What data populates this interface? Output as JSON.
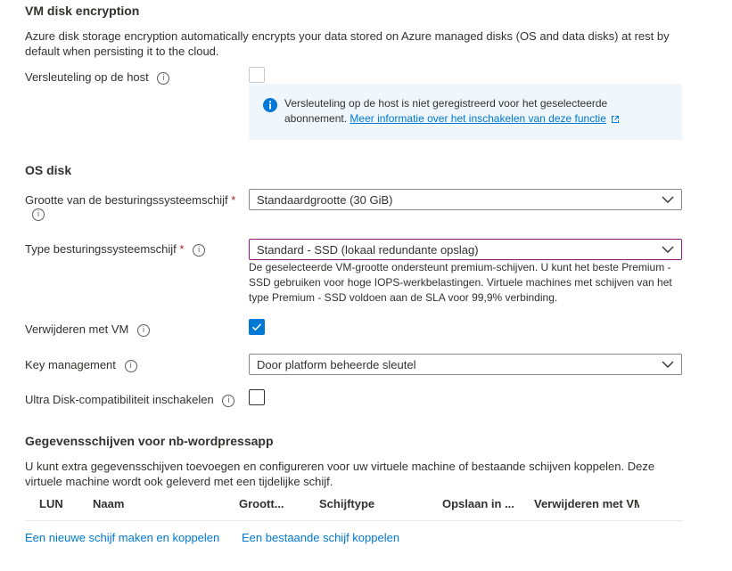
{
  "encryption": {
    "title": "VM disk encryption",
    "description": "Azure disk storage encryption automatically encrypts your data stored on Azure managed disks (OS and data disks) at rest by default when persisting it to the cloud.",
    "host_label": "Versleuteling op de host",
    "host_checked": false,
    "infobox_text": "Versleuteling op de host is niet geregistreerd voor het geselecteerde abonnement.",
    "infobox_link": "Meer informatie over het inschakelen van deze functie"
  },
  "os_disk": {
    "title": "OS disk",
    "size_label": "Grootte van de besturingssysteemschijf",
    "size_value": "Standaardgrootte (30 GiB)",
    "type_label": "Type besturingssysteemschijf",
    "type_value": "Standard - SSD (lokaal redundante opslag)",
    "type_help": "De geselecteerde VM-grootte ondersteunt premium-schijven. U kunt het beste Premium - SSD gebruiken voor hoge IOPS-werkbelastingen. Virtuele machines met schijven van het type Premium - SSD voldoen aan de SLA voor 99,9% verbinding.",
    "delete_label": "Verwijderen met VM",
    "delete_checked": true,
    "key_label": "Key management",
    "key_value": "Door platform beheerde sleutel",
    "ultra_label": "Ultra Disk-compatibiliteit inschakelen",
    "ultra_checked": false
  },
  "data_disks": {
    "title": "Gegevensschijven voor nb-wordpressapp",
    "description": "U kunt extra gegevensschijven toevoegen en configureren voor uw virtuele machine of bestaande schijven koppelen. Deze virtuele machine wordt ook geleverd met een tijdelijke schijf.",
    "columns": [
      "LUN",
      "Naam",
      "Groott...",
      "Schijftype",
      "Opslaan in ...",
      "Verwijderen met VM"
    ],
    "rows": [],
    "create_link": "Een nieuwe schijf maken en koppelen",
    "attach_link": "Een bestaande schijf koppelen"
  },
  "symbols": {
    "required": "*",
    "info": "i",
    "check": "✓"
  },
  "colors": {
    "accent": "#0078d4",
    "required": "#a4262c",
    "infobox_bg": "#eff6fc",
    "focus_border": "#8c1a7a"
  }
}
